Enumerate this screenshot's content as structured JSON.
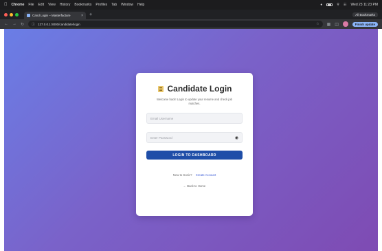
{
  "menubar": {
    "app_name": "Chrome",
    "items": [
      "File",
      "Edit",
      "View",
      "History",
      "Bookmarks",
      "Profiles",
      "Tab",
      "Window",
      "Help"
    ],
    "clock": "Wed 23 11:23 PM"
  },
  "browser": {
    "tab_title": "Cand Login – Masterfacture",
    "url": "127.0.0.1:8000/candidate/login",
    "update_label": "Finish update",
    "profile_label": "All Bookmarks"
  },
  "login": {
    "title": "Candidate Login",
    "subtitle": "Welcome back! Login to update your resume and check job matches.",
    "email_placeholder": "Email Username",
    "password_placeholder": "Enter Password",
    "login_button": "LOGIN TO DASHBOARD",
    "register_prompt": "New to Sonic?",
    "register_link": "Create Account",
    "back_link": "← Back to Home"
  },
  "colors": {
    "gradient_start": "#6a7ee6",
    "gradient_end": "#7e4bb3",
    "button": "#1f4ea8",
    "link": "#3b5bd6"
  }
}
